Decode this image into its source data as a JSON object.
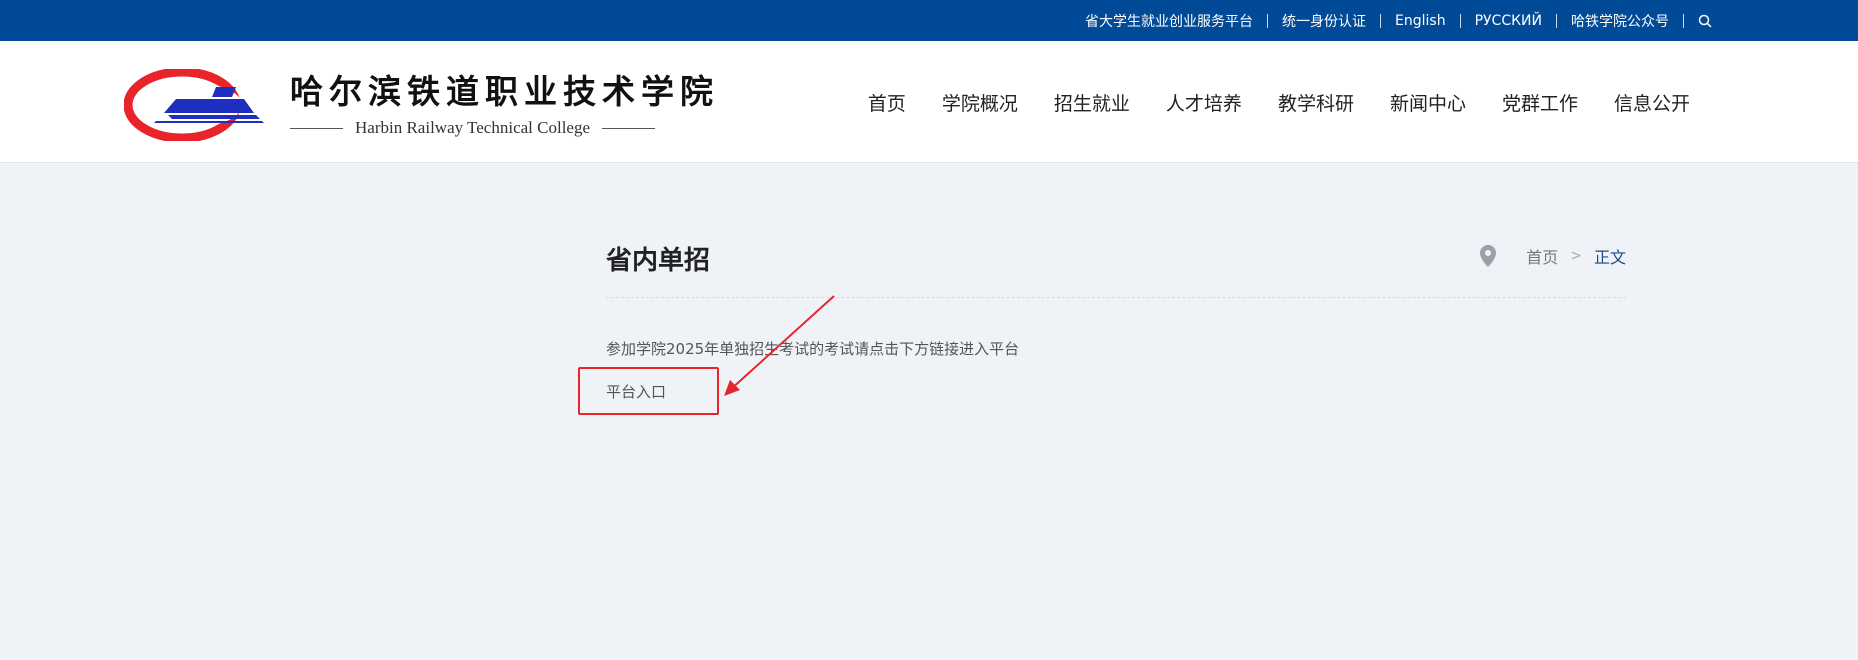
{
  "topbar": {
    "links": [
      "省大学生就业创业服务平台",
      "统一身份认证",
      "English",
      "РУССКИЙ",
      "哈铁学院公众号"
    ],
    "search_icon": "search-icon"
  },
  "header": {
    "logo_cn": "哈尔滨铁道职业技术学院",
    "logo_en": "Harbin Railway Technical College",
    "nav": [
      "首页",
      "学院概况",
      "招生就业",
      "人才培养",
      "教学科研",
      "新闻中心",
      "党群工作",
      "信息公开"
    ]
  },
  "page": {
    "title": "省内单招",
    "breadcrumb": {
      "home": "首页",
      "separator": ">",
      "current": "正文",
      "icon": "location-pin-icon"
    },
    "body_text": "参加学院2025年单独招生考试的考试请点击下方链接进入平台",
    "platform_link": "平台入口"
  },
  "colors": {
    "topbar_bg": "#004a97",
    "page_bg": "#eff3f7",
    "annotation_red": "#e8232a",
    "breadcrumb_current": "#1a4a8a"
  }
}
